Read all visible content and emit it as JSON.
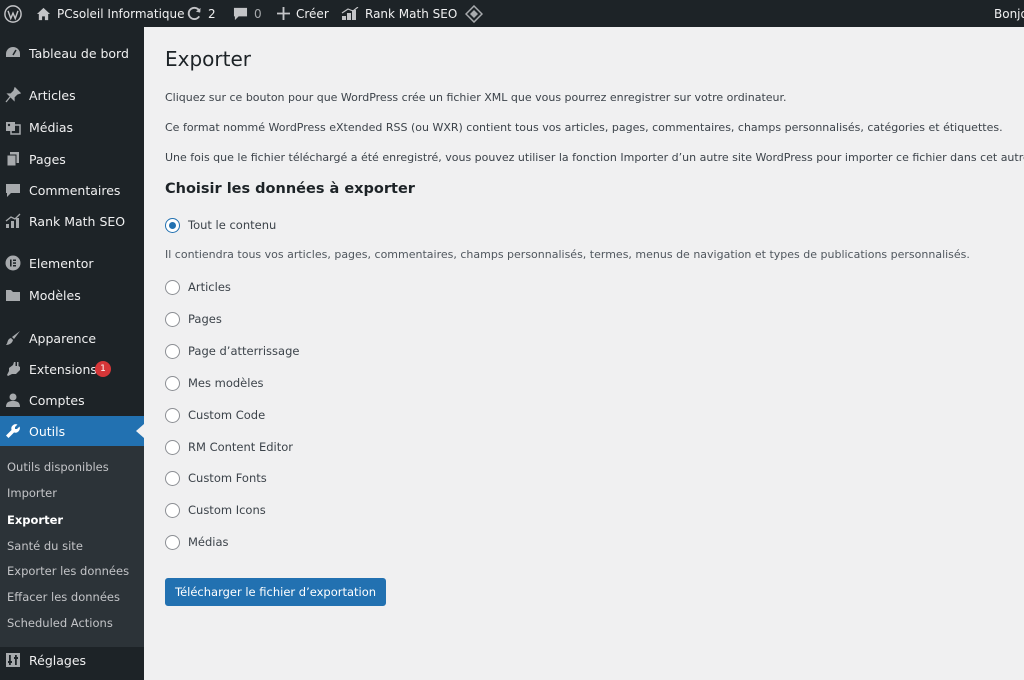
{
  "adminbar": {
    "site_name": "PCsoleil Informatique",
    "updates_count": "2",
    "comments_count": "0",
    "new_label": "Créer",
    "rankmath_label": "Rank Math SEO",
    "greeting": "Bonjo"
  },
  "sidebar": {
    "items": [
      {
        "label": "Tableau de bord",
        "icon": "dashboard-icon"
      },
      {
        "label": "Articles",
        "icon": "pin-icon"
      },
      {
        "label": "Médias",
        "icon": "media-icon"
      },
      {
        "label": "Pages",
        "icon": "pages-icon"
      },
      {
        "label": "Commentaires",
        "icon": "comment-icon"
      },
      {
        "label": "Rank Math SEO",
        "icon": "rankmath-icon"
      },
      {
        "label": "Elementor",
        "icon": "elementor-icon"
      },
      {
        "label": "Modèles",
        "icon": "folder-icon"
      },
      {
        "label": "Apparence",
        "icon": "brush-icon"
      },
      {
        "label": "Extensions",
        "icon": "plugin-icon",
        "badge": "1"
      },
      {
        "label": "Comptes",
        "icon": "user-icon"
      },
      {
        "label": "Outils",
        "icon": "wrench-icon",
        "current": true
      },
      {
        "label": "Réglages",
        "icon": "settings-icon"
      }
    ],
    "submenu": [
      "Outils disponibles",
      "Importer",
      "Exporter",
      "Santé du site",
      "Exporter les données",
      "Effacer les données",
      "Scheduled Actions"
    ]
  },
  "main": {
    "title": "Exporter",
    "paragraphs": [
      "Cliquez sur ce bouton pour que WordPress crée un fichier XML que vous pourrez enregistrer sur votre ordinateur.",
      "Ce format nommé WordPress eXtended RSS (ou WXR) contient tous vos articles, pages, commentaires, champs personnalisés, catégories et étiquettes.",
      "Une fois que le fichier téléchargé a été enregistré, vous pouvez utiliser la fonction Importer d’un autre site WordPress pour importer ce fichier dans cet autre site."
    ],
    "section_title": "Choisir les données à exporter",
    "options": [
      {
        "label": "Tout le contenu",
        "checked": true
      },
      {
        "label": "Articles"
      },
      {
        "label": "Pages"
      },
      {
        "label": "Page d’atterrissage"
      },
      {
        "label": "Mes modèles"
      },
      {
        "label": "Custom Code"
      },
      {
        "label": "RM Content Editor"
      },
      {
        "label": "Custom Fonts"
      },
      {
        "label": "Custom Icons"
      },
      {
        "label": "Médias"
      }
    ],
    "all_content_description": "Il contiendra tous vos articles, pages, commentaires, champs personnalisés, termes, menus de navigation et types de publications personnalisés.",
    "download_button": "Télécharger le fichier d’exportation"
  },
  "colors": {
    "adminbar_bg": "#1d2327",
    "accent": "#2271b1",
    "badge": "#d63638",
    "content_bg": "#f0f0f1"
  }
}
